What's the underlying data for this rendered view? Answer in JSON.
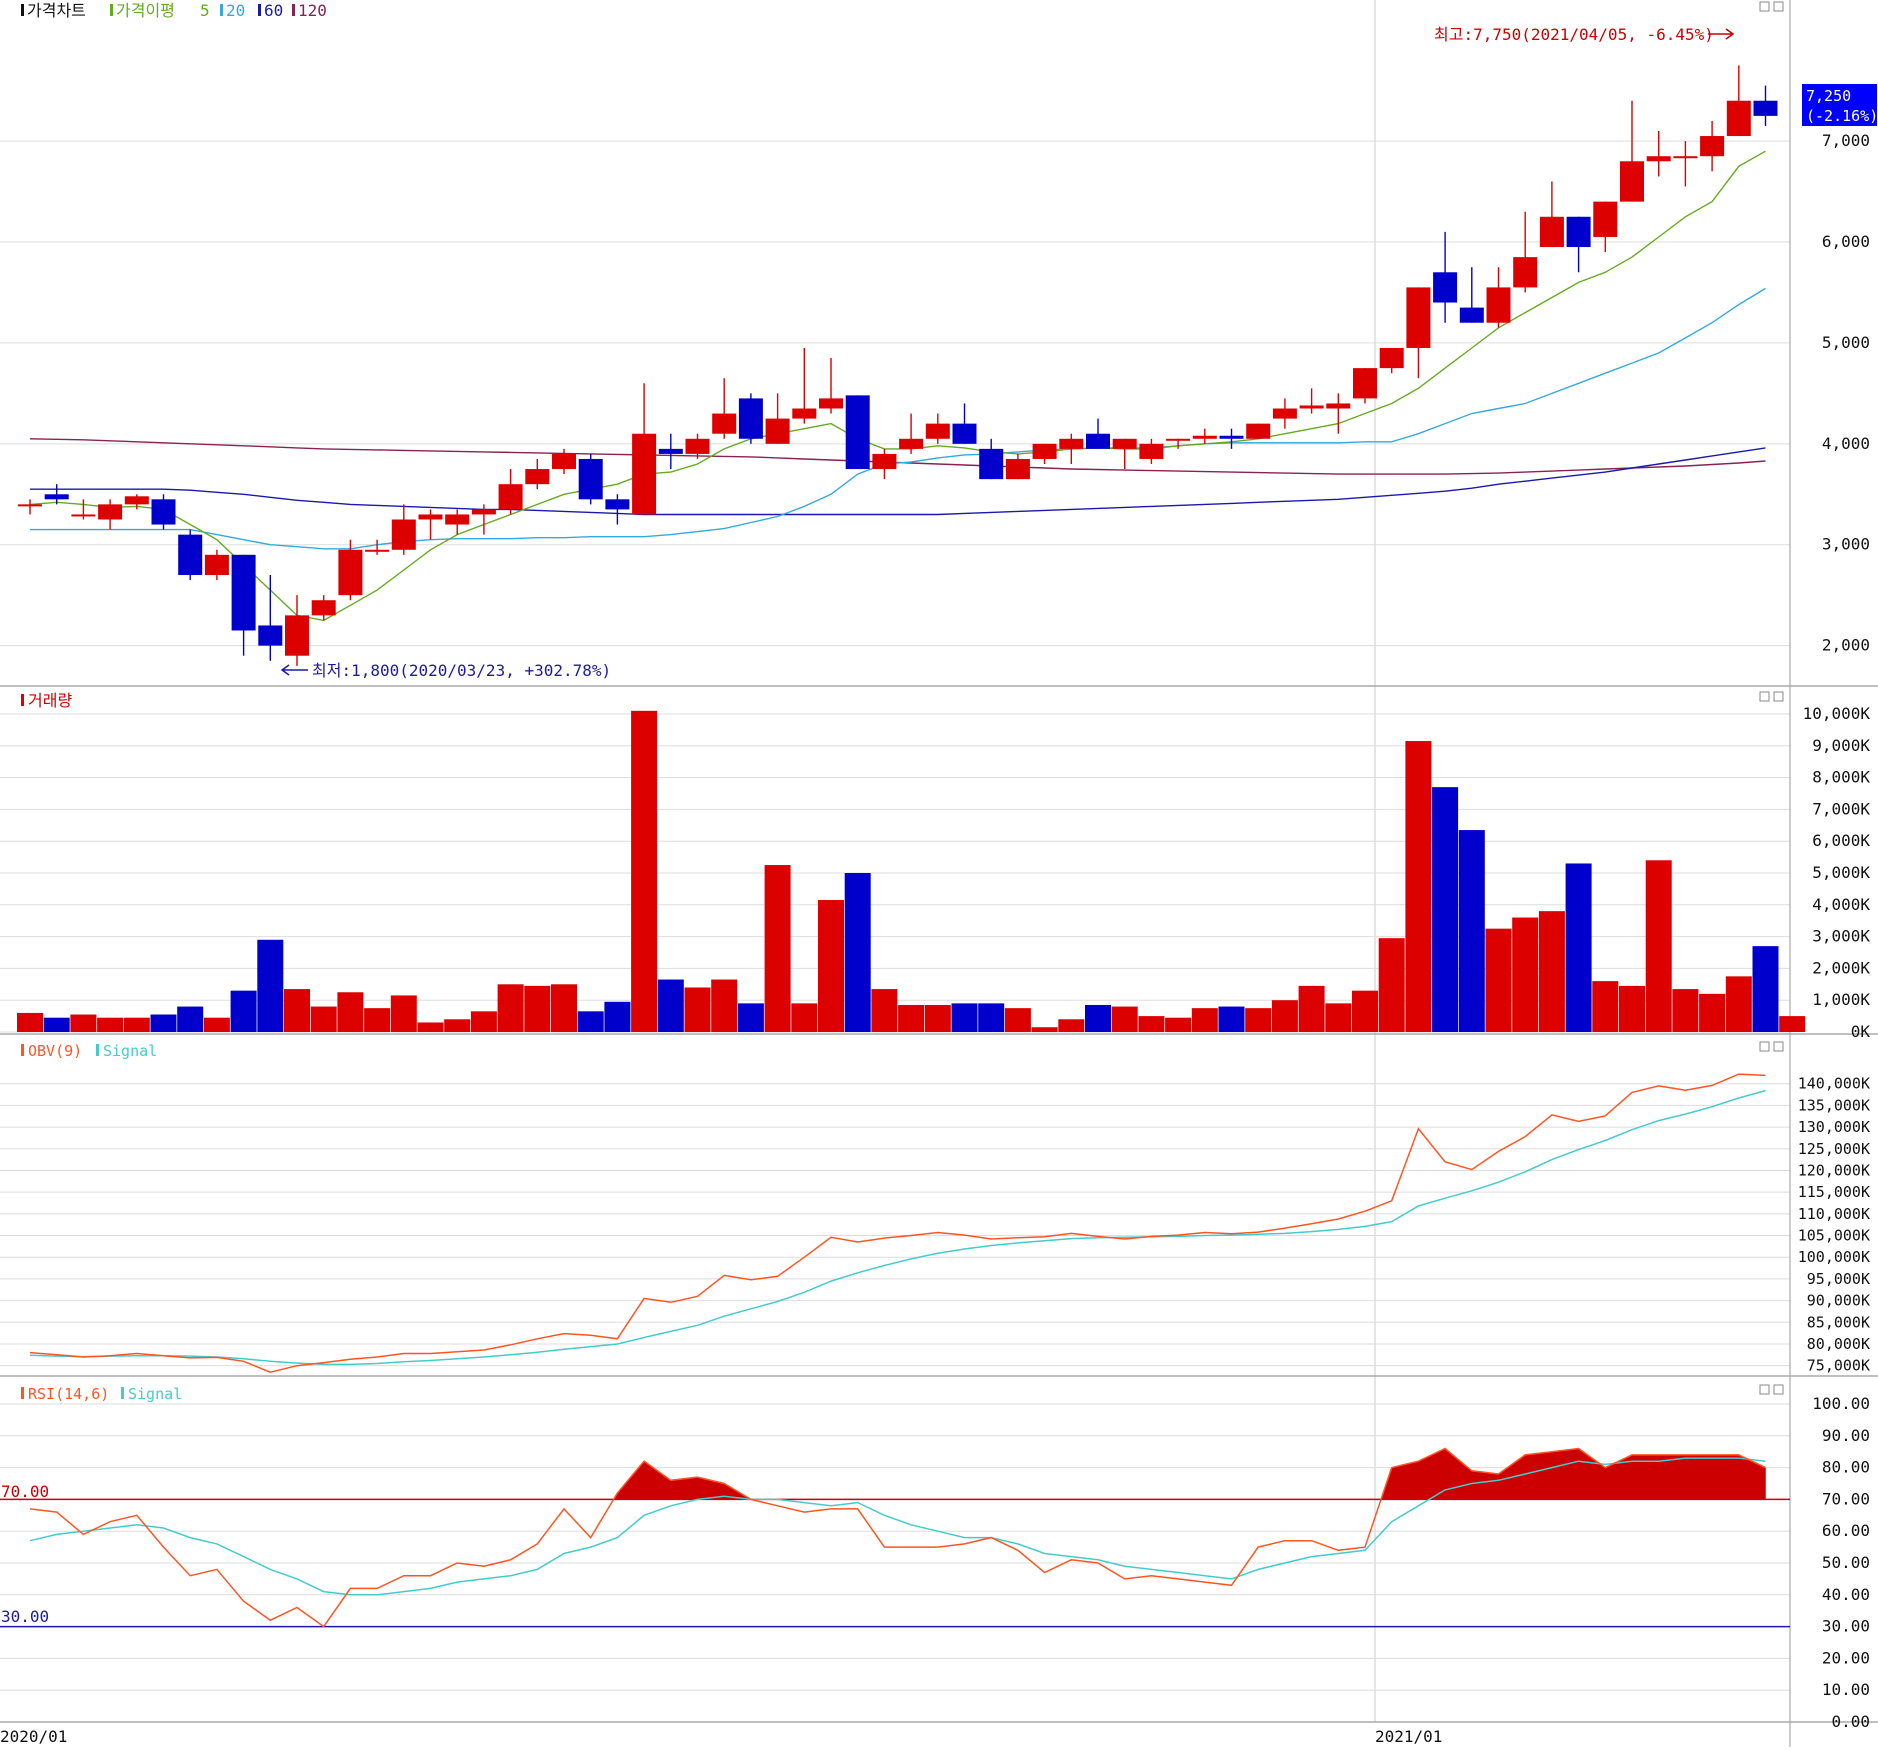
{
  "colors": {
    "up": "#dd0000",
    "down": "#0000cc",
    "ma5": "#66aa22",
    "ma20": "#33aadd",
    "ma60": "#1a1aaa",
    "ma120": "#882255",
    "obv": "#ff5522",
    "signal": "#44cccc",
    "rsi": "#ff5522",
    "rsi_fill": "#cc0000",
    "rsi70": "#cc0000",
    "rsi30": "#1a1aaa",
    "grid": "#dddddd",
    "text": "#111111",
    "price_badge_bg": "#0000ff"
  },
  "panels": {
    "price": {
      "title": "가격차트",
      "ma_title": "가격이평",
      "ma_periods": [
        "5",
        "20",
        "60",
        "120"
      ],
      "high_annotation": "최고:7,750(2021/04/05, -6.45%)",
      "low_annotation": "최저:1,800(2020/03/23, +302.78%)",
      "current_price": "7,250",
      "current_change": "(-2.16%)"
    },
    "volume": {
      "title": "거래량"
    },
    "obv": {
      "title": "OBV(9)",
      "signal": "Signal"
    },
    "rsi": {
      "title": "RSI(14,6)",
      "signal": "Signal",
      "level_high": "70.00",
      "level_low": "30.00"
    }
  },
  "chart_data": [
    {
      "type": "candlestick",
      "title": "가격차트",
      "yticks": [
        "2,000",
        "3,000",
        "4,000",
        "5,000",
        "6,000",
        "7,000"
      ],
      "ylim": [
        1600,
        8200
      ],
      "x_labels": [
        "2020/01",
        "2021/01"
      ],
      "candles": [
        {
          "o": 3400,
          "h": 3450,
          "l": 3300,
          "c": 3400
        },
        {
          "o": 3500,
          "h": 3600,
          "l": 3400,
          "c": 3450
        },
        {
          "o": 3300,
          "h": 3450,
          "l": 3250,
          "c": 3300
        },
        {
          "o": 3250,
          "h": 3450,
          "l": 3150,
          "c": 3400
        },
        {
          "o": 3400,
          "h": 3500,
          "l": 3350,
          "c": 3480
        },
        {
          "o": 3450,
          "h": 3500,
          "l": 3150,
          "c": 3200
        },
        {
          "o": 3100,
          "h": 3150,
          "l": 2650,
          "c": 2700
        },
        {
          "o": 2700,
          "h": 2950,
          "l": 2650,
          "c": 2900
        },
        {
          "o": 2900,
          "h": 2900,
          "l": 1900,
          "c": 2150
        },
        {
          "o": 2200,
          "h": 2700,
          "l": 1850,
          "c": 2000
        },
        {
          "o": 1900,
          "h": 2500,
          "l": 1800,
          "c": 2300
        },
        {
          "o": 2300,
          "h": 2500,
          "l": 2250,
          "c": 2450
        },
        {
          "o": 2500,
          "h": 3050,
          "l": 2450,
          "c": 2950
        },
        {
          "o": 2950,
          "h": 3050,
          "l": 2900,
          "c": 2950
        },
        {
          "o": 2950,
          "h": 3400,
          "l": 2900,
          "c": 3250
        },
        {
          "o": 3250,
          "h": 3350,
          "l": 3050,
          "c": 3300
        },
        {
          "o": 3200,
          "h": 3350,
          "l": 3100,
          "c": 3300
        },
        {
          "o": 3300,
          "h": 3400,
          "l": 3100,
          "c": 3350
        },
        {
          "o": 3350,
          "h": 3750,
          "l": 3300,
          "c": 3600
        },
        {
          "o": 3600,
          "h": 3850,
          "l": 3550,
          "c": 3750
        },
        {
          "o": 3750,
          "h": 3950,
          "l": 3700,
          "c": 3900
        },
        {
          "o": 3850,
          "h": 3900,
          "l": 3400,
          "c": 3450
        },
        {
          "o": 3450,
          "h": 3500,
          "l": 3200,
          "c": 3350
        },
        {
          "o": 3300,
          "h": 4600,
          "l": 3300,
          "c": 4100
        },
        {
          "o": 3950,
          "h": 4100,
          "l": 3750,
          "c": 3900
        },
        {
          "o": 3900,
          "h": 4100,
          "l": 3850,
          "c": 4050
        },
        {
          "o": 4100,
          "h": 4650,
          "l": 4050,
          "c": 4300
        },
        {
          "o": 4450,
          "h": 4500,
          "l": 4000,
          "c": 4050
        },
        {
          "o": 4000,
          "h": 4500,
          "l": 4000,
          "c": 4250
        },
        {
          "o": 4250,
          "h": 4950,
          "l": 4200,
          "c": 4350
        },
        {
          "o": 4350,
          "h": 4850,
          "l": 4300,
          "c": 4450
        },
        {
          "o": 4480,
          "h": 4480,
          "l": 3750,
          "c": 3750
        },
        {
          "o": 3750,
          "h": 3950,
          "l": 3650,
          "c": 3900
        },
        {
          "o": 3950,
          "h": 4300,
          "l": 3900,
          "c": 4050
        },
        {
          "o": 4050,
          "h": 4300,
          "l": 4000,
          "c": 4200
        },
        {
          "o": 4200,
          "h": 4400,
          "l": 4000,
          "c": 4000
        },
        {
          "o": 3950,
          "h": 4050,
          "l": 3650,
          "c": 3650
        },
        {
          "o": 3650,
          "h": 3900,
          "l": 3650,
          "c": 3850
        },
        {
          "o": 3850,
          "h": 4000,
          "l": 3800,
          "c": 4000
        },
        {
          "o": 3950,
          "h": 4100,
          "l": 3800,
          "c": 4050
        },
        {
          "o": 4100,
          "h": 4250,
          "l": 3950,
          "c": 3950
        },
        {
          "o": 3950,
          "h": 4050,
          "l": 3750,
          "c": 4050
        },
        {
          "o": 3850,
          "h": 4050,
          "l": 3800,
          "c": 4000
        },
        {
          "o": 4050,
          "h": 4050,
          "l": 3950,
          "c": 4050
        },
        {
          "o": 4050,
          "h": 4150,
          "l": 4000,
          "c": 4080
        },
        {
          "o": 4080,
          "h": 4150,
          "l": 3950,
          "c": 4050
        },
        {
          "o": 4050,
          "h": 4200,
          "l": 4050,
          "c": 4200
        },
        {
          "o": 4250,
          "h": 4450,
          "l": 4150,
          "c": 4350
        },
        {
          "o": 4350,
          "h": 4550,
          "l": 4300,
          "c": 4380
        },
        {
          "o": 4350,
          "h": 4500,
          "l": 4100,
          "c": 4400
        },
        {
          "o": 4450,
          "h": 4750,
          "l": 4400,
          "c": 4750
        },
        {
          "o": 4750,
          "h": 4950,
          "l": 4700,
          "c": 4950
        },
        {
          "o": 4950,
          "h": 5550,
          "l": 4650,
          "c": 5550
        },
        {
          "o": 5700,
          "h": 6100,
          "l": 5200,
          "c": 5400
        },
        {
          "o": 5350,
          "h": 5750,
          "l": 5200,
          "c": 5200
        },
        {
          "o": 5200,
          "h": 5750,
          "l": 5150,
          "c": 5550
        },
        {
          "o": 5550,
          "h": 6300,
          "l": 5500,
          "c": 5850
        },
        {
          "o": 5950,
          "h": 6600,
          "l": 5950,
          "c": 6250
        },
        {
          "o": 6250,
          "h": 6150,
          "l": 5700,
          "c": 5950
        },
        {
          "o": 6050,
          "h": 6400,
          "l": 5900,
          "c": 6400
        },
        {
          "o": 6400,
          "h": 7400,
          "l": 6400,
          "c": 6800
        },
        {
          "o": 6800,
          "h": 7100,
          "l": 6650,
          "c": 6850
        },
        {
          "o": 6850,
          "h": 7000,
          "l": 6550,
          "c": 6850
        },
        {
          "o": 6850,
          "h": 7200,
          "l": 6700,
          "c": 7050
        },
        {
          "o": 7050,
          "h": 7750,
          "l": 7150,
          "c": 7400
        },
        {
          "o": 7400,
          "h": 7550,
          "l": 7150,
          "c": 7250
        }
      ],
      "ma5": [
        3400,
        3420,
        3400,
        3370,
        3380,
        3350,
        3200,
        3050,
        2800,
        2550,
        2300,
        2250,
        2400,
        2550,
        2750,
        2950,
        3100,
        3200,
        3300,
        3400,
        3500,
        3550,
        3600,
        3700,
        3720,
        3800,
        3950,
        4050,
        4100,
        4150,
        4200,
        4050,
        3950,
        3950,
        3980,
        3960,
        3920,
        3900,
        3920,
        3950,
        3960,
        3950,
        3950,
        3980,
        4000,
        4020,
        4050,
        4100,
        4150,
        4200,
        4300,
        4400,
        4550,
        4750,
        4950,
        5150,
        5300,
        5450,
        5600,
        5700,
        5850,
        6050,
        6250,
        6400,
        6750,
        6900
      ],
      "ma20": [
        3150,
        3150,
        3150,
        3150,
        3150,
        3150,
        3150,
        3100,
        3050,
        3000,
        2980,
        2960,
        2960,
        3000,
        3030,
        3050,
        3060,
        3060,
        3060,
        3070,
        3070,
        3080,
        3080,
        3080,
        3100,
        3130,
        3160,
        3220,
        3280,
        3380,
        3500,
        3700,
        3800,
        3820,
        3860,
        3890,
        3900,
        3920,
        3940,
        3950,
        3960,
        3960,
        3960,
        3980,
        4000,
        4010,
        4010,
        4010,
        4010,
        4010,
        4020,
        4020,
        4100,
        4200,
        4300,
        4350,
        4400,
        4500,
        4600,
        4700,
        4800,
        4900,
        5050,
        5200,
        5380,
        5540
      ],
      "ma60": [
        3550,
        3550,
        3550,
        3550,
        3550,
        3550,
        3540,
        3520,
        3500,
        3470,
        3440,
        3420,
        3400,
        3390,
        3380,
        3370,
        3360,
        3350,
        3350,
        3340,
        3330,
        3320,
        3310,
        3300,
        3300,
        3300,
        3300,
        3300,
        3300,
        3300,
        3300,
        3300,
        3300,
        3300,
        3300,
        3310,
        3320,
        3330,
        3340,
        3350,
        3360,
        3370,
        3380,
        3390,
        3400,
        3410,
        3420,
        3430,
        3440,
        3450,
        3470,
        3490,
        3510,
        3530,
        3560,
        3600,
        3630,
        3660,
        3690,
        3720,
        3760,
        3800,
        3840,
        3880,
        3920,
        3960
      ],
      "ma120": [
        4050,
        4045,
        4040,
        4030,
        4020,
        4010,
        4000,
        3990,
        3980,
        3970,
        3960,
        3950,
        3945,
        3940,
        3935,
        3930,
        3925,
        3920,
        3915,
        3910,
        3905,
        3900,
        3895,
        3890,
        3885,
        3880,
        3875,
        3870,
        3860,
        3850,
        3840,
        3830,
        3820,
        3810,
        3800,
        3790,
        3780,
        3770,
        3760,
        3750,
        3745,
        3740,
        3735,
        3730,
        3725,
        3720,
        3715,
        3710,
        3705,
        3700,
        3700,
        3700,
        3700,
        3700,
        3705,
        3710,
        3720,
        3730,
        3740,
        3750,
        3760,
        3770,
        3780,
        3795,
        3810,
        3830
      ]
    },
    {
      "type": "bar",
      "title": "거래량",
      "yticks": [
        "0K",
        "1,000K",
        "2,000K",
        "3,000K",
        "4,000K",
        "5,000K",
        "6,000K",
        "7,000K",
        "8,000K",
        "9,000K",
        "10,000K"
      ],
      "ylim": [
        0,
        10000
      ],
      "unit": "K",
      "values": [
        600,
        450,
        550,
        450,
        450,
        550,
        800,
        450,
        1300,
        2900,
        1350,
        800,
        1250,
        750,
        1150,
        300,
        400,
        650,
        1500,
        1450,
        1500,
        650,
        950,
        10100,
        1650,
        1400,
        1650,
        900,
        5250,
        900,
        4150,
        5000,
        1350,
        850,
        850,
        900,
        900,
        750,
        150,
        400,
        850,
        800,
        500,
        450,
        750,
        800,
        750,
        1000,
        1450,
        900,
        1300,
        2950,
        9150,
        7700,
        6350,
        3250,
        3600,
        3800,
        5300,
        1600,
        1450,
        5400,
        1350,
        1200,
        1750,
        2700,
        500
      ]
    },
    {
      "type": "line",
      "title": "OBV(9)",
      "yticks": [
        "75,000K",
        "80,000K",
        "85,000K",
        "90,000K",
        "95,000K",
        "100,000K",
        "105,000K",
        "110,000K",
        "115,000K",
        "120,000K",
        "125,000K",
        "130,000K",
        "135,000K",
        "140,000K"
      ],
      "ylim": [
        74000,
        145000
      ],
      "series": [
        {
          "name": "OBV(9)",
          "values": [
            78000,
            77500,
            77000,
            77300,
            77800,
            77300,
            76800,
            76900,
            76000,
            73500,
            75000,
            75700,
            76500,
            77000,
            77800,
            77800,
            78200,
            78600,
            79800,
            81200,
            82400,
            82000,
            81200,
            90500,
            89600,
            91000,
            95800,
            94800,
            95600,
            100000,
            104600,
            103500,
            104400,
            105000,
            105700,
            105100,
            104200,
            104500,
            104700,
            105500,
            104800,
            104200,
            104800,
            105100,
            105700,
            105400,
            105800,
            106700,
            107700,
            108800,
            110600,
            113000,
            129600,
            122000,
            120200,
            124400,
            127800,
            132800,
            131300,
            132600,
            138000,
            139500,
            138500,
            139600,
            142200,
            141900
          ]
        },
        {
          "name": "Signal",
          "values": [
            77400,
            77200,
            77100,
            77200,
            77300,
            77300,
            77200,
            77000,
            76600,
            76000,
            75600,
            75300,
            75300,
            75500,
            75900,
            76200,
            76600,
            77000,
            77500,
            78100,
            78800,
            79400,
            80000,
            81500,
            82900,
            84300,
            86400,
            88100,
            89800,
            91900,
            94500,
            96400,
            98100,
            99600,
            100900,
            101900,
            102700,
            103300,
            103800,
            104300,
            104500,
            104600,
            104700,
            104800,
            105000,
            105100,
            105300,
            105500,
            105900,
            106400,
            107100,
            108200,
            111800,
            113600,
            115300,
            117300,
            119700,
            122500,
            124800,
            126900,
            129400,
            131500,
            133000,
            134700,
            136700,
            138400
          ]
        }
      ]
    },
    {
      "type": "line",
      "title": "RSI(14,6)",
      "yticks": [
        "0.00",
        "10.00",
        "20.00",
        "30.00",
        "40.00",
        "50.00",
        "60.00",
        "70.00",
        "80.00",
        "90.00",
        "100.00"
      ],
      "ylim": [
        0,
        100
      ],
      "levels": [
        70,
        30
      ],
      "series": [
        {
          "name": "RSI(14,6)",
          "values": [
            67,
            66,
            59,
            63,
            65,
            55,
            46,
            48,
            38,
            32,
            36,
            30,
            42,
            42,
            46,
            46,
            50,
            49,
            51,
            56,
            67,
            58,
            72,
            82,
            76,
            77,
            75,
            70,
            68,
            66,
            67,
            67,
            55,
            55,
            55,
            56,
            58,
            54,
            47,
            51,
            50,
            45,
            46,
            45,
            44,
            43,
            55,
            57,
            57,
            54,
            55,
            80,
            82,
            86,
            79,
            78,
            84,
            85,
            86,
            80,
            84,
            84,
            84,
            84,
            84,
            80
          ]
        },
        {
          "name": "Signal",
          "values": [
            57,
            59,
            60,
            61,
            62,
            61,
            58,
            56,
            52,
            48,
            45,
            41,
            40,
            40,
            41,
            42,
            44,
            45,
            46,
            48,
            53,
            55,
            58,
            65,
            68,
            70,
            71,
            70,
            70,
            69,
            68,
            69,
            65,
            62,
            60,
            58,
            58,
            56,
            53,
            52,
            51,
            49,
            48,
            47,
            46,
            45,
            48,
            50,
            52,
            53,
            54,
            63,
            68,
            73,
            75,
            76,
            78,
            80,
            82,
            81,
            82,
            82,
            83,
            83,
            83,
            82
          ]
        }
      ]
    }
  ]
}
